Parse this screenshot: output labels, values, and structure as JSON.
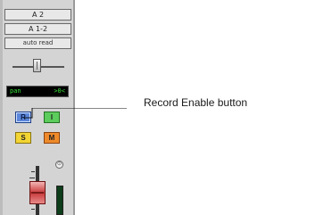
{
  "strip": {
    "output_label": "A 2",
    "input_label": "A 1-2",
    "automation_label": "auto read",
    "pan_display": {
      "label": "pan",
      "value": ">0<"
    },
    "buttons": {
      "record": "R",
      "input": "I",
      "solo": "S",
      "mute": "M"
    }
  },
  "callout": {
    "text": "Record Enable button"
  },
  "colors": {
    "record": "#5b86d9",
    "input": "#5ccc5c",
    "solo": "#f2d533",
    "mute": "#ef8a2a",
    "fader": "#c83a3a",
    "pan_text": "#38e03a"
  }
}
